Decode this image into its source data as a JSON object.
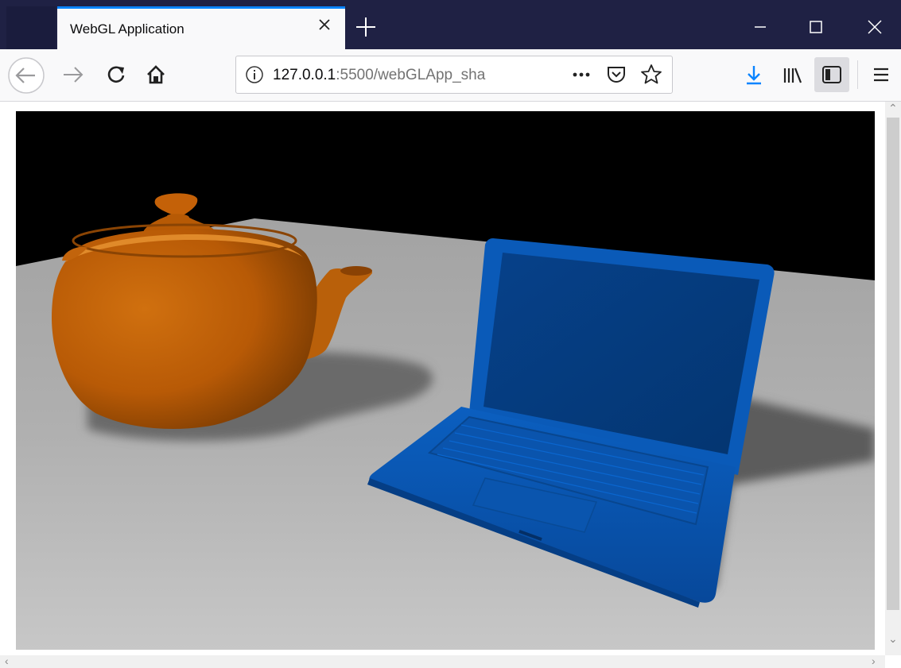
{
  "window": {
    "tab_title": "WebGL Application"
  },
  "toolbar": {
    "url_host": "127.0.0.1",
    "url_path": ":5500/webGLApp_sha",
    "icons": [
      "back-arrow",
      "forward-arrow",
      "reload",
      "home",
      "site-info",
      "page-actions",
      "pocket",
      "bookmark-star",
      "download-arrow",
      "library",
      "sidebar",
      "hamburger-menu"
    ]
  },
  "colors": {
    "tabbar_bg": "#1f2144",
    "accent": "#0a84ff",
    "download_icon": "#0a84ff",
    "floor": "#a8a8a8",
    "teapot": "#c8630a",
    "laptop": "#0a5ab8",
    "sky": "#000000"
  },
  "scene": {
    "objects": [
      "teapot",
      "laptop",
      "floor-plane"
    ]
  }
}
